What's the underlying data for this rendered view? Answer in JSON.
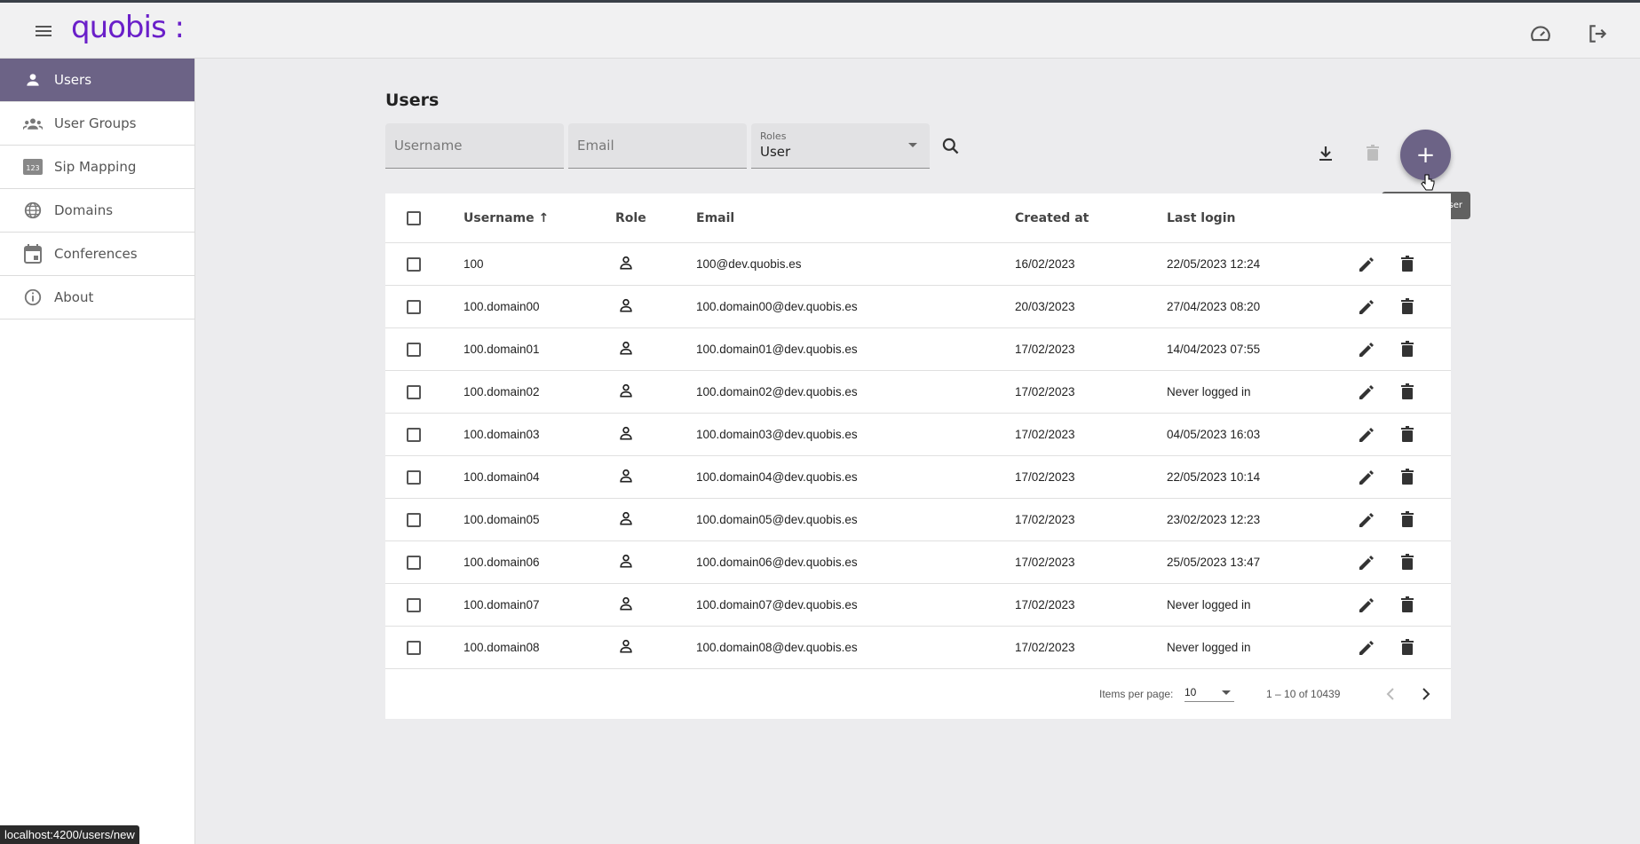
{
  "app": {
    "logo": "quobis :"
  },
  "sidebar": {
    "items": [
      {
        "label": "Users",
        "icon": "person-icon",
        "active": true
      },
      {
        "label": "User Groups",
        "icon": "groups-icon",
        "active": false
      },
      {
        "label": "Sip Mapping",
        "icon": "dialpad-123-icon",
        "active": false
      },
      {
        "label": "Domains",
        "icon": "globe-icon",
        "active": false
      },
      {
        "label": "Conferences",
        "icon": "calendar-icon",
        "active": false
      },
      {
        "label": "About",
        "icon": "info-icon",
        "active": false
      }
    ]
  },
  "page": {
    "title": "Users"
  },
  "filters": {
    "username_placeholder": "Username",
    "email_placeholder": "Email",
    "roles_label": "Roles",
    "roles_value": "User"
  },
  "actions": {
    "create_tooltip": "Create new user"
  },
  "table": {
    "headers": {
      "username": "Username",
      "sort_arrow": "↑",
      "role": "Role",
      "email": "Email",
      "created": "Created at",
      "last_login": "Last login"
    },
    "rows": [
      {
        "username": "100",
        "email": "100@dev.quobis.es",
        "created": "16/02/2023",
        "last_login": "22/05/2023 12:24"
      },
      {
        "username": "100.domain00",
        "email": "100.domain00@dev.quobis.es",
        "created": "20/03/2023",
        "last_login": "27/04/2023 08:20"
      },
      {
        "username": "100.domain01",
        "email": "100.domain01@dev.quobis.es",
        "created": "17/02/2023",
        "last_login": "14/04/2023 07:55"
      },
      {
        "username": "100.domain02",
        "email": "100.domain02@dev.quobis.es",
        "created": "17/02/2023",
        "last_login": "Never logged in"
      },
      {
        "username": "100.domain03",
        "email": "100.domain03@dev.quobis.es",
        "created": "17/02/2023",
        "last_login": "04/05/2023 16:03"
      },
      {
        "username": "100.domain04",
        "email": "100.domain04@dev.quobis.es",
        "created": "17/02/2023",
        "last_login": "22/05/2023 10:14"
      },
      {
        "username": "100.domain05",
        "email": "100.domain05@dev.quobis.es",
        "created": "17/02/2023",
        "last_login": "23/02/2023 12:23"
      },
      {
        "username": "100.domain06",
        "email": "100.domain06@dev.quobis.es",
        "created": "17/02/2023",
        "last_login": "25/05/2023 13:47"
      },
      {
        "username": "100.domain07",
        "email": "100.domain07@dev.quobis.es",
        "created": "17/02/2023",
        "last_login": "Never logged in"
      },
      {
        "username": "100.domain08",
        "email": "100.domain08@dev.quobis.es",
        "created": "17/02/2023",
        "last_login": "Never logged in"
      }
    ]
  },
  "paginator": {
    "items_per_page_label": "Items per page:",
    "page_size": "10",
    "range": "1 – 10 of 10439"
  },
  "status_bar": {
    "url": "localhost:4200/users/new"
  },
  "colors": {
    "brand": "#6a1fc9",
    "accent": "#6c6386"
  }
}
